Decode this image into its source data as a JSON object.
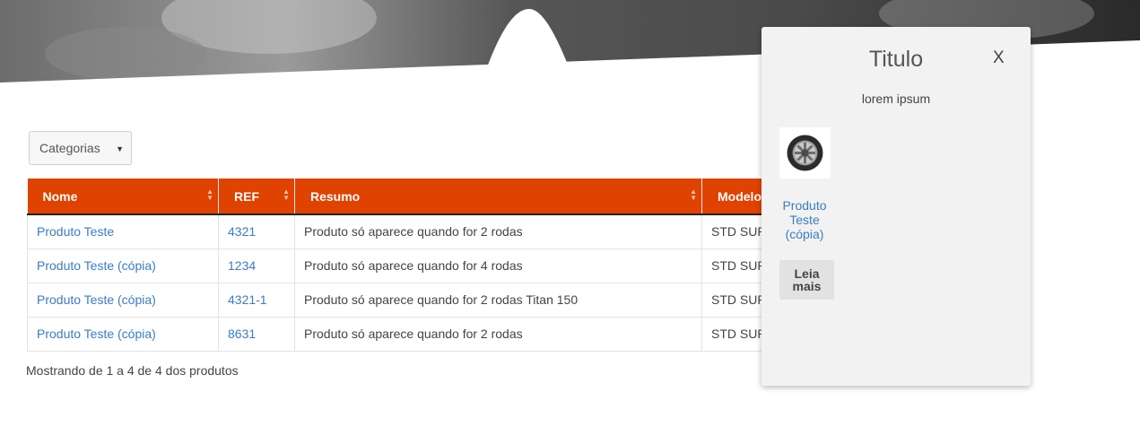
{
  "filter": {
    "category_label": "Categorias"
  },
  "table": {
    "columns": [
      "Nome",
      "REF",
      "Resumo",
      "Modelo"
    ],
    "rows": [
      [
        "Produto Teste",
        "4321",
        "Produto só aparece quando for 2 rodas",
        "STD SUP"
      ],
      [
        "Produto Teste (cópia)",
        "1234",
        "Produto só aparece quando for 4 rodas",
        "STD SUP"
      ],
      [
        "Produto Teste (cópia)",
        "4321-1",
        "Produto só aparece quando for 2 rodas Titan 150",
        "STD SUP"
      ],
      [
        "Produto Teste (cópia)",
        "8631",
        "Produto só aparece quando for 2 rodas",
        "STD SUP"
      ]
    ],
    "footer": "Mostrando de 1 a 4 de 4 dos produtos"
  },
  "panel": {
    "title": "Titulo",
    "close_label": "X",
    "subtitle": "lorem ipsum",
    "product_name": "Produto Teste (cópia)",
    "read_more": "Leia mais"
  },
  "colors": {
    "header": "#e04200",
    "link": "#3a7cc4",
    "panel_bg": "#f2f2f2"
  }
}
